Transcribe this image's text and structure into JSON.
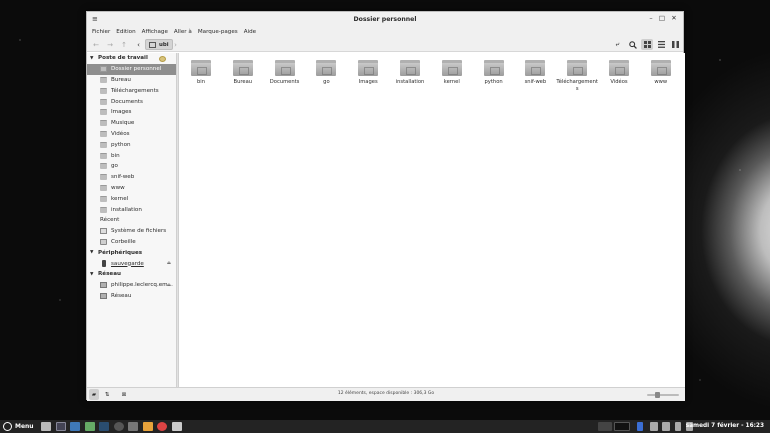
{
  "window": {
    "title": "Dossier personnel",
    "menu_icon": "≡",
    "min": "–",
    "max": "□",
    "close": "✕"
  },
  "menubar": [
    "Fichier",
    "Edition",
    "Affichage",
    "Aller à",
    "Marque-pages",
    "Aide"
  ],
  "toolbar": {
    "back": "←",
    "forward": "→",
    "up": "↑",
    "crumb_prev": "‹",
    "crumb_next": "›",
    "path": "ubi"
  },
  "sidebar": {
    "section1": "Poste de travail",
    "items": [
      {
        "label": "Dossier personnel",
        "icon": "home-icon"
      },
      {
        "label": "Bureau",
        "icon": "folder-icon"
      },
      {
        "label": "Téléchargements",
        "icon": "folder-icon"
      },
      {
        "label": "Documents",
        "icon": "folder-icon"
      },
      {
        "label": "Images",
        "icon": "folder-icon"
      },
      {
        "label": "Musique",
        "icon": "folder-icon"
      },
      {
        "label": "Vidéos",
        "icon": "folder-icon"
      },
      {
        "label": "python",
        "icon": "folder-icon"
      },
      {
        "label": "bin",
        "icon": "folder-icon"
      },
      {
        "label": "go",
        "icon": "folder-icon"
      },
      {
        "label": "snif-web",
        "icon": "folder-icon"
      },
      {
        "label": "www",
        "icon": "folder-icon"
      },
      {
        "label": "kernel",
        "icon": "folder-icon"
      },
      {
        "label": "installation",
        "icon": "folder-icon"
      },
      {
        "label": "Récent",
        "icon": "recent-icon"
      },
      {
        "label": "Système de fichiers",
        "icon": "drive-icon"
      },
      {
        "label": "Corbeille",
        "icon": "trash-icon"
      }
    ],
    "section2": "Périphériques",
    "devices": [
      {
        "label": "sauvegarde",
        "icon": "usb-icon"
      }
    ],
    "section3": "Réseau",
    "network": [
      {
        "label": "philippe.leclercq.em...",
        "icon": "network-drive-icon"
      },
      {
        "label": "Réseau",
        "icon": "network-icon"
      }
    ]
  },
  "files": [
    "bin",
    "Bureau",
    "Documents",
    "go",
    "Images",
    "installation",
    "kernel",
    "python",
    "snif-web",
    "Téléchargements",
    "Vidéos",
    "www"
  ],
  "status": {
    "text": "12 éléments, espace disponible : 306,3 Go"
  },
  "taskbar": {
    "menu": "Menu",
    "clock": "samedi 7 février - 16:23"
  }
}
